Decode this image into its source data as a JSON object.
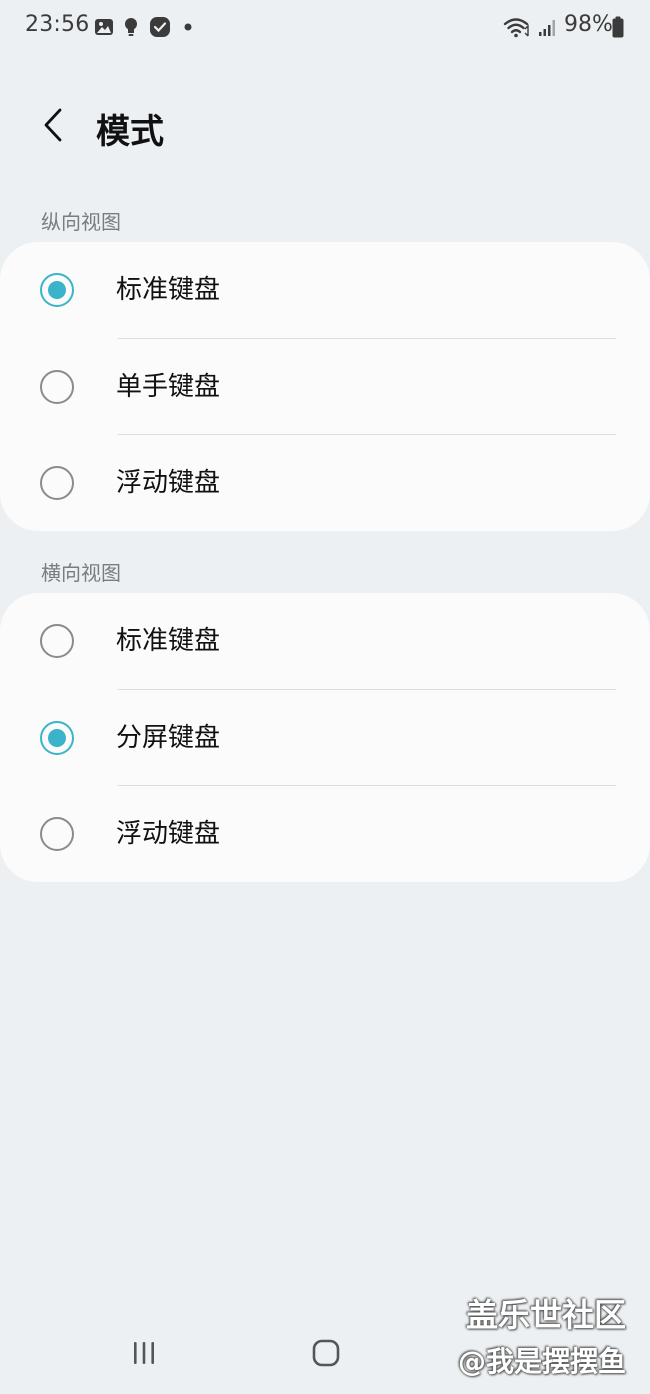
{
  "status_bar": {
    "time": "23:56",
    "left_icons": [
      "gallery-icon",
      "bulb-icon",
      "check-badge-icon",
      "dot-icon"
    ],
    "right_icons": [
      "wifi-icon",
      "signal-icon",
      "battery-icon"
    ],
    "battery_percent": "98%"
  },
  "header": {
    "title": "模式",
    "back_icon": "chevron-left-icon"
  },
  "portrait": {
    "label": "纵向视图",
    "options": [
      {
        "label": "标准键盘",
        "checked": true
      },
      {
        "label": "单手键盘",
        "checked": false
      },
      {
        "label": "浮动键盘",
        "checked": false
      }
    ]
  },
  "landscape": {
    "label": "横向视图",
    "options": [
      {
        "label": "标准键盘",
        "checked": false
      },
      {
        "label": "分屏键盘",
        "checked": true
      },
      {
        "label": "浮动键盘",
        "checked": false
      }
    ]
  },
  "nav_bar": {
    "icons": [
      "recents-icon",
      "home-icon",
      "back-icon"
    ]
  },
  "watermark": {
    "line1": "盖乐世社区",
    "line2": "@我是摆摆鱼"
  },
  "colors": {
    "background": "#edf0f2",
    "card": "#fbfbfb",
    "accent": "#3ab4c8",
    "section_label": "#7a7d80"
  }
}
